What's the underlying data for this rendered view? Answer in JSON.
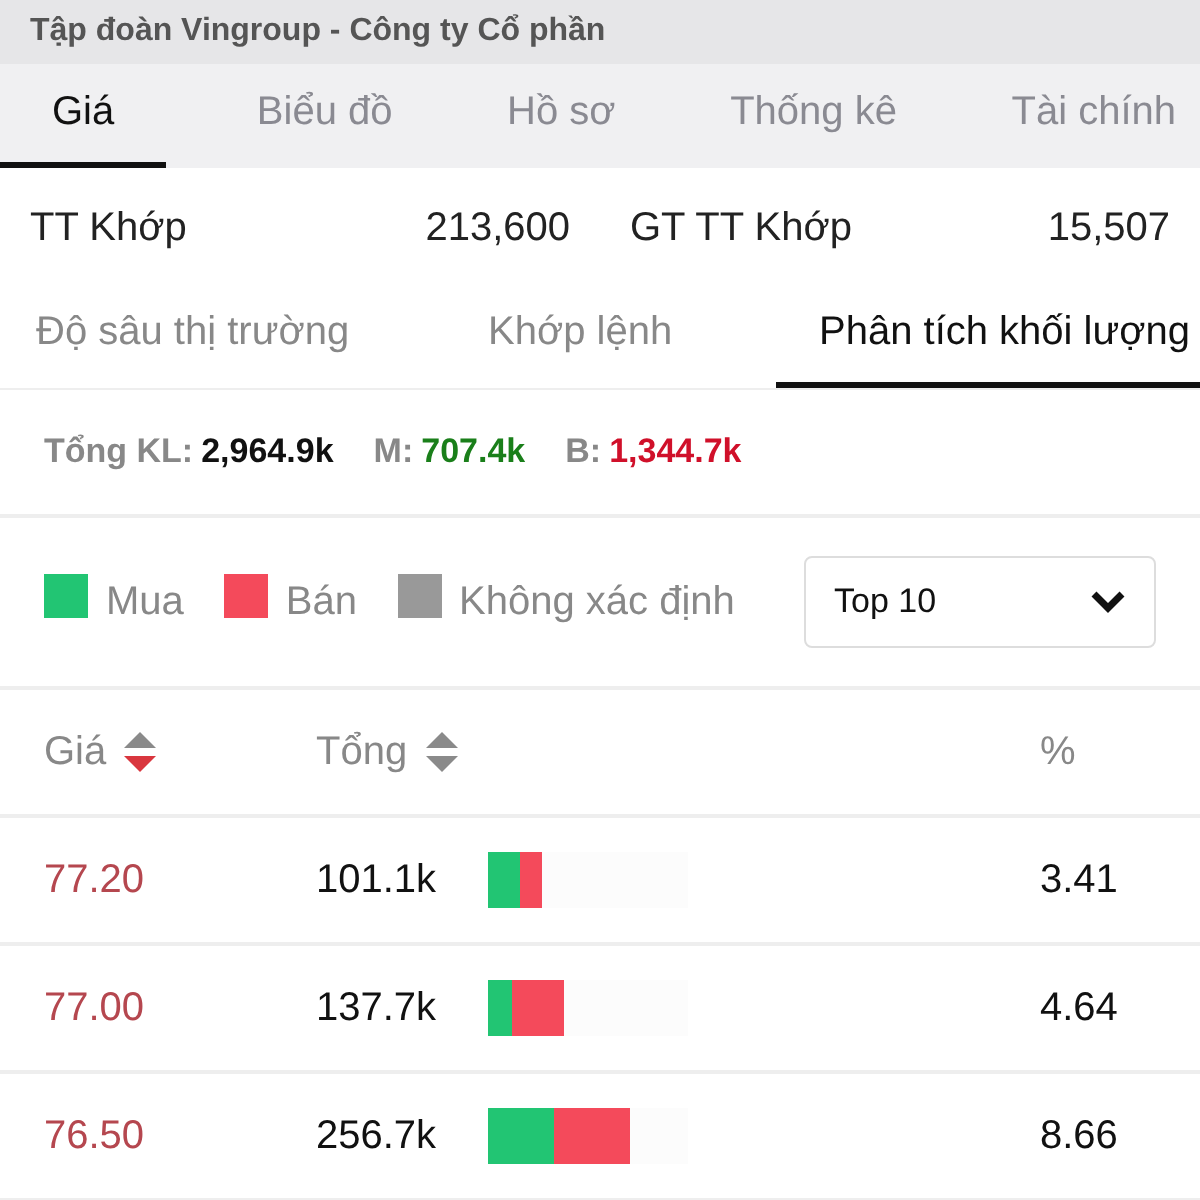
{
  "title": "Tập đoàn Vingroup - Công ty Cổ phần",
  "tabs": [
    {
      "label": "Giá",
      "selected": true
    },
    {
      "label": "Biểu đồ",
      "selected": false
    },
    {
      "label": "Hồ sơ",
      "selected": false
    },
    {
      "label": "Thống kê",
      "selected": false
    },
    {
      "label": "Tài chính",
      "selected": false
    }
  ],
  "info": [
    {
      "label": "TT Khớp",
      "value": "213,600"
    },
    {
      "label": "GT TT Khớp",
      "value": "15,507"
    }
  ],
  "subtabs": [
    {
      "label": "Độ sâu thị trường",
      "selected": false
    },
    {
      "label": "Khớp lệnh",
      "selected": false
    },
    {
      "label": "Phân tích khối lượng",
      "selected": true
    }
  ],
  "summary": [
    {
      "label": "Tổng KL:",
      "value": "2,964.9k",
      "kind": "total"
    },
    {
      "label": "M:",
      "value": "707.4k",
      "kind": "buy"
    },
    {
      "label": "B:",
      "value": "1,344.7k",
      "kind": "sell"
    }
  ],
  "legend": [
    {
      "label": "Mua",
      "color": "#22c573"
    },
    {
      "label": "Bán",
      "color": "#f44a5b"
    },
    {
      "label": "Không xác định",
      "color": "#999999"
    }
  ],
  "dropdown": {
    "value": "Top 10"
  },
  "columns": [
    {
      "label": "Giá",
      "kind": "sortable",
      "sorted": true
    },
    {
      "label": "Tổng",
      "kind": "sortable",
      "sorted": false
    },
    {
      "label": "%",
      "kind": "plain"
    }
  ],
  "rows": [
    {
      "price": "77.20",
      "total": "101.1k",
      "percent": "3.41",
      "buy": {
        "level": 0.16
      },
      "sell": {
        "level": 0.13
      }
    },
    {
      "price": "77.00",
      "total": "137.7k",
      "percent": "4.64",
      "buy": {
        "level": 0.12
      },
      "sell": {
        "level": 0.3
      }
    },
    {
      "price": "76.50",
      "total": "256.7k",
      "percent": "8.66",
      "buy": {
        "level": 0.33
      },
      "sell": {
        "level": 0.57
      }
    }
  ]
}
